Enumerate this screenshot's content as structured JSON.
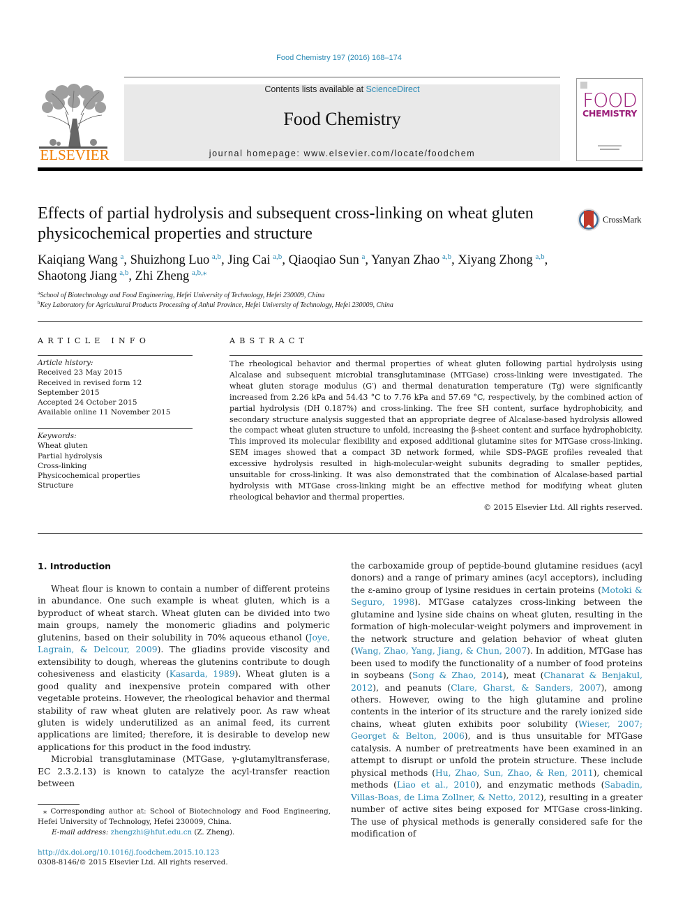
{
  "header": {
    "citation": "Food Chemistry 197 (2016) 168–174",
    "publisher": "ELSEVIER",
    "contents_prefix": "Contents lists available at ",
    "contents_link": "ScienceDirect",
    "journal_title": "Food Chemistry",
    "homepage": "journal homepage: www.elsevier.com/locate/foodchem",
    "cover": {
      "line1": "FOOD",
      "line2": "CHEMISTRY"
    }
  },
  "colors": {
    "link": "#2a8ab5",
    "elsevier_orange": "#f07d00",
    "cover_magenta": "#9c1f7a",
    "masthead_bg": "#e9e9e9",
    "crossmark_red": "#c0392b"
  },
  "article": {
    "title": "Effects of partial hydrolysis and subsequent cross-linking on wheat gluten physicochemical properties and structure",
    "crossmark_label": "CrossMark",
    "authors": [
      {
        "name": "Kaiqiang Wang",
        "aff": "a",
        "sep": ", "
      },
      {
        "name": "Shuizhong Luo",
        "aff": "a,b",
        "sep": ", "
      },
      {
        "name": "Jing Cai",
        "aff": "a,b",
        "sep": ", "
      },
      {
        "name": "Qiaoqiao Sun",
        "aff": "a",
        "sep": ", "
      },
      {
        "name": "Yanyan Zhao",
        "aff": "a,b",
        "sep": ", "
      },
      {
        "name": "Xiyang Zhong",
        "aff": "a,b",
        "sep": ", "
      },
      {
        "name": "Shaotong Jiang",
        "aff": "a,b",
        "sep": ", "
      },
      {
        "name": "Zhi Zheng",
        "aff": "a,b,⁎",
        "sep": ""
      }
    ],
    "affiliations": [
      {
        "key": "a",
        "text": "School of Biotechnology and Food Engineering, Hefei University of Technology, Hefei 230009, China"
      },
      {
        "key": "b",
        "text": "Key Laboratory for Agricultural Products Processing of Anhui Province, Hefei University of Technology, Hefei 230009, China"
      }
    ]
  },
  "article_info": {
    "heading": "ARTICLE INFO",
    "history_label": "Article history:",
    "history": [
      "Received 23 May 2015",
      "Received in revised form 12 September 2015",
      "Accepted 24 October 2015",
      "Available online 11 November 2015"
    ],
    "keywords_label": "Keywords:",
    "keywords": [
      "Wheat gluten",
      "Partial hydrolysis",
      "Cross-linking",
      "Physicochemical properties",
      "Structure"
    ]
  },
  "abstract": {
    "heading": "ABSTRACT",
    "text": "The rheological behavior and thermal properties of wheat gluten following partial hydrolysis using Alcalase and subsequent microbial transglutaminase (MTGase) cross-linking were investigated. The wheat gluten storage modulus (G′) and thermal denaturation temperature (Tg) were significantly increased from 2.26 kPa and 54.43 °C to 7.76 kPa and 57.69 °C, respectively, by the combined action of partial hydrolysis (DH 0.187%) and cross-linking. The free SH content, surface hydrophobicity, and secondary structure analysis suggested that an appropriate degree of Alcalase-based hydrolysis allowed the compact wheat gluten structure to unfold, increasing the β-sheet content and surface hydrophobicity. This improved its molecular flexibility and exposed additional glutamine sites for MTGase cross-linking. SEM images showed that a compact 3D network formed, while SDS–PAGE profiles revealed that excessive hydrolysis resulted in high-molecular-weight subunits degrading to smaller peptides, unsuitable for cross-linking. It was also demonstrated that the combination of Alcalase-based partial hydrolysis with MTGase cross-linking might be an effective method for modifying wheat gluten rheological behavior and thermal properties.",
    "copyright": "© 2015 Elsevier Ltd. All rights reserved."
  },
  "body": {
    "intro_heading": "1. Introduction",
    "left_paragraphs": [
      [
        {
          "t": "Wheat flour is known to contain a number of different proteins in abundance. One such example is wheat gluten, which is a byproduct of wheat starch. Wheat gluten can be divided into two main groups, namely the monomeric gliadins and polymeric glutenins, based on their solubility in 70% aqueous ethanol ("
        },
        {
          "t": "Joye, Lagrain, & Delcour, 2009",
          "link": true
        },
        {
          "t": "). The gliadins provide viscosity and extensibility to dough, whereas the glutenins contribute to dough cohesiveness and elasticity ("
        },
        {
          "t": "Kasarda, 1989",
          "link": true
        },
        {
          "t": "). Wheat gluten is a good quality and inexpensive protein compared with other vegetable proteins. However, the rheological behavior and thermal stability of raw wheat gluten are relatively poor. As raw wheat gluten is widely underutilized as an animal feed, its current applications are limited; therefore, it is desirable to develop new applications for this product in the food industry."
        }
      ],
      [
        {
          "t": "Microbial transglutaminase (MTGase, γ-glutamyltransferase, EC 2.3.2.13) is known to catalyze the acyl-transfer reaction between"
        }
      ]
    ],
    "right_paragraphs": [
      [
        {
          "t": "the carboxamide group of peptide-bound glutamine residues (acyl donors) and a range of primary amines (acyl acceptors), including the ε-amino group of lysine residues in certain proteins ("
        },
        {
          "t": "Motoki & Seguro, 1998",
          "link": true
        },
        {
          "t": "). MTGase catalyzes cross-linking between the glutamine and lysine side chains on wheat gluten, resulting in the formation of high-molecular-weight polymers and improvement in the network structure and gelation behavior of wheat gluten ("
        },
        {
          "t": "Wang, Zhao, Yang, Jiang, & Chun, 2007",
          "link": true
        },
        {
          "t": "). In addition, MTGase has been used to modify the functionality of a number of food proteins in soybeans ("
        },
        {
          "t": "Song & Zhao, 2014",
          "link": true
        },
        {
          "t": "), meat ("
        },
        {
          "t": "Chanarat & Benjakul, 2012",
          "link": true
        },
        {
          "t": "), and peanuts ("
        },
        {
          "t": "Clare, Gharst, & Sanders, 2007",
          "link": true
        },
        {
          "t": "), among others. However, owing to the high glutamine and proline contents in the interior of its structure and the rarely ionized side chains, wheat gluten exhibits poor solubility ("
        },
        {
          "t": "Wieser, 2007; Georget & Belton, 2006",
          "link": true
        },
        {
          "t": "), and is thus unsuitable for MTGase catalysis. A number of pretreatments have been examined in an attempt to disrupt or unfold the protein structure. These include physical methods ("
        },
        {
          "t": "Hu, Zhao, Sun, Zhao, & Ren, 2011",
          "link": true
        },
        {
          "t": "), chemical methods ("
        },
        {
          "t": "Liao et al., 2010",
          "link": true
        },
        {
          "t": "), and enzymatic methods ("
        },
        {
          "t": "Sabadin, Villas-Boas, de Lima Zollner, & Netto, 2012",
          "link": true
        },
        {
          "t": "), resulting in a greater number of active sites being exposed for MTGase cross-linking. The use of physical methods is generally considered safe for the modification of"
        }
      ]
    ]
  },
  "footnote": {
    "corresponding": "⁎ Corresponding author at: School of Biotechnology and Food Engineering, Hefei University of Technology, Hefei 230009, China.",
    "email_label": "E-mail address: ",
    "email": "zhengzhi@hfut.edu.cn",
    "email_suffix": " (Z. Zheng).",
    "doi": "http://dx.doi.org/10.1016/j.foodchem.2015.10.123",
    "issn": "0308-8146/© 2015 Elsevier Ltd. All rights reserved."
  }
}
